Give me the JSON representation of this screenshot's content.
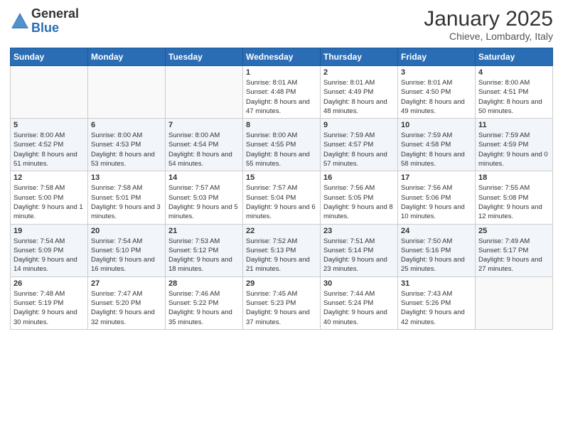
{
  "header": {
    "logo_general": "General",
    "logo_blue": "Blue",
    "month": "January 2025",
    "location": "Chieve, Lombardy, Italy"
  },
  "weekdays": [
    "Sunday",
    "Monday",
    "Tuesday",
    "Wednesday",
    "Thursday",
    "Friday",
    "Saturday"
  ],
  "weeks": [
    [
      {
        "day": "",
        "sunrise": "",
        "sunset": "",
        "daylight": ""
      },
      {
        "day": "",
        "sunrise": "",
        "sunset": "",
        "daylight": ""
      },
      {
        "day": "",
        "sunrise": "",
        "sunset": "",
        "daylight": ""
      },
      {
        "day": "1",
        "sunrise": "Sunrise: 8:01 AM",
        "sunset": "Sunset: 4:48 PM",
        "daylight": "Daylight: 8 hours and 47 minutes."
      },
      {
        "day": "2",
        "sunrise": "Sunrise: 8:01 AM",
        "sunset": "Sunset: 4:49 PM",
        "daylight": "Daylight: 8 hours and 48 minutes."
      },
      {
        "day": "3",
        "sunrise": "Sunrise: 8:01 AM",
        "sunset": "Sunset: 4:50 PM",
        "daylight": "Daylight: 8 hours and 49 minutes."
      },
      {
        "day": "4",
        "sunrise": "Sunrise: 8:00 AM",
        "sunset": "Sunset: 4:51 PM",
        "daylight": "Daylight: 8 hours and 50 minutes."
      }
    ],
    [
      {
        "day": "5",
        "sunrise": "Sunrise: 8:00 AM",
        "sunset": "Sunset: 4:52 PM",
        "daylight": "Daylight: 8 hours and 51 minutes."
      },
      {
        "day": "6",
        "sunrise": "Sunrise: 8:00 AM",
        "sunset": "Sunset: 4:53 PM",
        "daylight": "Daylight: 8 hours and 53 minutes."
      },
      {
        "day": "7",
        "sunrise": "Sunrise: 8:00 AM",
        "sunset": "Sunset: 4:54 PM",
        "daylight": "Daylight: 8 hours and 54 minutes."
      },
      {
        "day": "8",
        "sunrise": "Sunrise: 8:00 AM",
        "sunset": "Sunset: 4:55 PM",
        "daylight": "Daylight: 8 hours and 55 minutes."
      },
      {
        "day": "9",
        "sunrise": "Sunrise: 7:59 AM",
        "sunset": "Sunset: 4:57 PM",
        "daylight": "Daylight: 8 hours and 57 minutes."
      },
      {
        "day": "10",
        "sunrise": "Sunrise: 7:59 AM",
        "sunset": "Sunset: 4:58 PM",
        "daylight": "Daylight: 8 hours and 58 minutes."
      },
      {
        "day": "11",
        "sunrise": "Sunrise: 7:59 AM",
        "sunset": "Sunset: 4:59 PM",
        "daylight": "Daylight: 9 hours and 0 minutes."
      }
    ],
    [
      {
        "day": "12",
        "sunrise": "Sunrise: 7:58 AM",
        "sunset": "Sunset: 5:00 PM",
        "daylight": "Daylight: 9 hours and 1 minute."
      },
      {
        "day": "13",
        "sunrise": "Sunrise: 7:58 AM",
        "sunset": "Sunset: 5:01 PM",
        "daylight": "Daylight: 9 hours and 3 minutes."
      },
      {
        "day": "14",
        "sunrise": "Sunrise: 7:57 AM",
        "sunset": "Sunset: 5:03 PM",
        "daylight": "Daylight: 9 hours and 5 minutes."
      },
      {
        "day": "15",
        "sunrise": "Sunrise: 7:57 AM",
        "sunset": "Sunset: 5:04 PM",
        "daylight": "Daylight: 9 hours and 6 minutes."
      },
      {
        "day": "16",
        "sunrise": "Sunrise: 7:56 AM",
        "sunset": "Sunset: 5:05 PM",
        "daylight": "Daylight: 9 hours and 8 minutes."
      },
      {
        "day": "17",
        "sunrise": "Sunrise: 7:56 AM",
        "sunset": "Sunset: 5:06 PM",
        "daylight": "Daylight: 9 hours and 10 minutes."
      },
      {
        "day": "18",
        "sunrise": "Sunrise: 7:55 AM",
        "sunset": "Sunset: 5:08 PM",
        "daylight": "Daylight: 9 hours and 12 minutes."
      }
    ],
    [
      {
        "day": "19",
        "sunrise": "Sunrise: 7:54 AM",
        "sunset": "Sunset: 5:09 PM",
        "daylight": "Daylight: 9 hours and 14 minutes."
      },
      {
        "day": "20",
        "sunrise": "Sunrise: 7:54 AM",
        "sunset": "Sunset: 5:10 PM",
        "daylight": "Daylight: 9 hours and 16 minutes."
      },
      {
        "day": "21",
        "sunrise": "Sunrise: 7:53 AM",
        "sunset": "Sunset: 5:12 PM",
        "daylight": "Daylight: 9 hours and 18 minutes."
      },
      {
        "day": "22",
        "sunrise": "Sunrise: 7:52 AM",
        "sunset": "Sunset: 5:13 PM",
        "daylight": "Daylight: 9 hours and 21 minutes."
      },
      {
        "day": "23",
        "sunrise": "Sunrise: 7:51 AM",
        "sunset": "Sunset: 5:14 PM",
        "daylight": "Daylight: 9 hours and 23 minutes."
      },
      {
        "day": "24",
        "sunrise": "Sunrise: 7:50 AM",
        "sunset": "Sunset: 5:16 PM",
        "daylight": "Daylight: 9 hours and 25 minutes."
      },
      {
        "day": "25",
        "sunrise": "Sunrise: 7:49 AM",
        "sunset": "Sunset: 5:17 PM",
        "daylight": "Daylight: 9 hours and 27 minutes."
      }
    ],
    [
      {
        "day": "26",
        "sunrise": "Sunrise: 7:48 AM",
        "sunset": "Sunset: 5:19 PM",
        "daylight": "Daylight: 9 hours and 30 minutes."
      },
      {
        "day": "27",
        "sunrise": "Sunrise: 7:47 AM",
        "sunset": "Sunset: 5:20 PM",
        "daylight": "Daylight: 9 hours and 32 minutes."
      },
      {
        "day": "28",
        "sunrise": "Sunrise: 7:46 AM",
        "sunset": "Sunset: 5:22 PM",
        "daylight": "Daylight: 9 hours and 35 minutes."
      },
      {
        "day": "29",
        "sunrise": "Sunrise: 7:45 AM",
        "sunset": "Sunset: 5:23 PM",
        "daylight": "Daylight: 9 hours and 37 minutes."
      },
      {
        "day": "30",
        "sunrise": "Sunrise: 7:44 AM",
        "sunset": "Sunset: 5:24 PM",
        "daylight": "Daylight: 9 hours and 40 minutes."
      },
      {
        "day": "31",
        "sunrise": "Sunrise: 7:43 AM",
        "sunset": "Sunset: 5:26 PM",
        "daylight": "Daylight: 9 hours and 42 minutes."
      },
      {
        "day": "",
        "sunrise": "",
        "sunset": "",
        "daylight": ""
      }
    ]
  ]
}
